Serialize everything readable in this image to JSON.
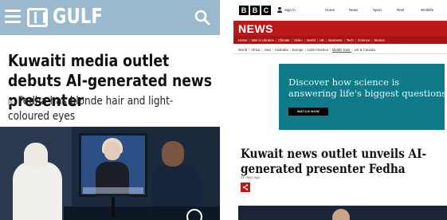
{
  "left": {
    "brand": "GULF",
    "headline": "Kuwaiti media outlet debuts AI-generated news presenter",
    "subhead": "Fedha has blonde hair and light-coloured eyes",
    "header_color": "#9ab9cf",
    "icons": {
      "menu": "hamburger-menu-icon",
      "search": "search-icon",
      "bullet": "triangle-bullet-icon"
    }
  },
  "right": {
    "logo_letters": [
      "B",
      "B",
      "C"
    ],
    "signin": "Sign in",
    "nav": [
      "Home",
      "News",
      "Sport",
      "Reel",
      "Worklife"
    ],
    "section_title": "NEWS",
    "sections": [
      "Home",
      "War in Ukraine",
      "Climate",
      "Video",
      "World",
      "UK",
      "Business",
      "Tech",
      "Science",
      "Stories"
    ],
    "subsections": [
      "World",
      "Africa",
      "Asia",
      "Australia",
      "Europe",
      "Latin America",
      "Middle East",
      "US & Canada"
    ],
    "active_subsection": "Middle East",
    "ad": {
      "line1": "Discover how science is",
      "line2": "answering life's biggest questions",
      "button": "WATCH NOW"
    },
    "headline": "Kuwait news outlet unveils AI-generated presenter Fedha",
    "timestamp": "21 days ago",
    "brand_color": "#bb1919"
  }
}
